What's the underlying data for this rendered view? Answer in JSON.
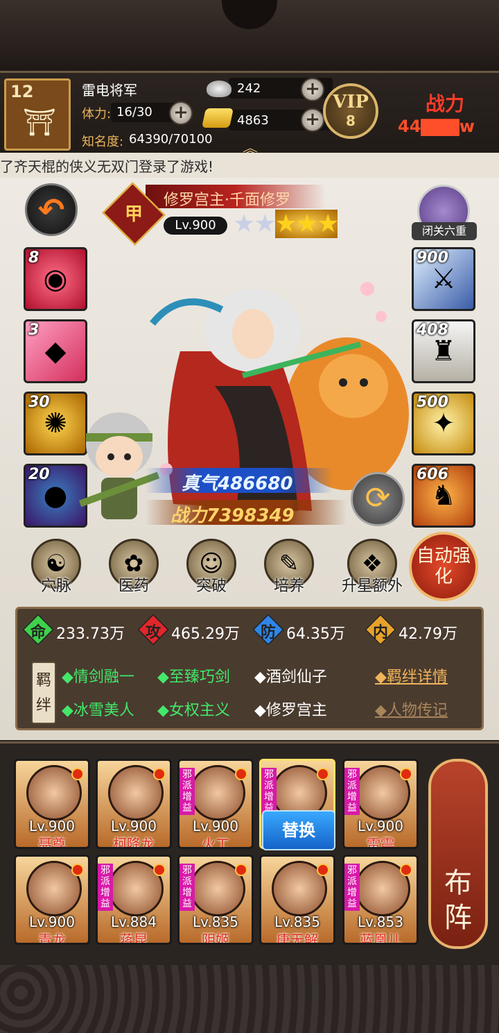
{
  "player": {
    "level": "12",
    "name": "雷电将军",
    "stamina_label": "体力:",
    "stamina_value": "16/30",
    "fame_label": "知名度:",
    "fame_value": "64390/70100",
    "silver": "242",
    "gold": "4863",
    "vip_text": "VIP",
    "vip_level": "8",
    "power_label": "战力",
    "power_value": "44▇▇▇w"
  },
  "marquee": "了齐天棍的侠义无双门登录了游戏!",
  "hero": {
    "rank": "甲",
    "title": "修罗宫主·千面修罗",
    "level": "Lv.900",
    "stars_silver": "★★",
    "stars_gold": "★★★",
    "seclusion_label": "闭关六重",
    "qi_text": "真气486680",
    "power_text": "战力7398349"
  },
  "left_slots": [
    {
      "num": "8",
      "icon": "red-swirl-icon",
      "glyph": "◉"
    },
    {
      "num": "3",
      "icon": "pink-crystal-icon",
      "glyph": "◆"
    },
    {
      "num": "30",
      "icon": "golden-aura-icon",
      "glyph": "✺"
    },
    {
      "num": "20",
      "icon": "blue-orb-icon",
      "glyph": "●"
    }
  ],
  "right_slots": [
    {
      "num": "900",
      "icon": "sword-icon",
      "glyph": "🗡"
    },
    {
      "num": "408",
      "icon": "robe-icon",
      "glyph": "♜"
    },
    {
      "num": "500",
      "icon": "gems-icon",
      "glyph": "✦"
    },
    {
      "num": "606",
      "icon": "tiger-icon",
      "glyph": "🐯"
    }
  ],
  "functions": [
    {
      "label": "穴脉",
      "icon": "meridian-icon",
      "glyph": "☯"
    },
    {
      "label": "医药",
      "icon": "medicine-icon",
      "glyph": "✿"
    },
    {
      "label": "突破",
      "icon": "breakthrough-icon",
      "glyph": "☺"
    },
    {
      "label": "培养",
      "icon": "training-scroll-icon",
      "glyph": "✎"
    },
    {
      "label": "升星额外",
      "icon": "star-up-icon",
      "glyph": "❖"
    }
  ],
  "auto_strengthen": "自动强化",
  "stats": [
    {
      "char": "命",
      "value": "233.73万",
      "color": "#3fd14b"
    },
    {
      "char": "攻",
      "value": "465.29万",
      "color": "#e0272b"
    },
    {
      "char": "防",
      "value": "64.35万",
      "color": "#2f86e8"
    },
    {
      "char": "内",
      "value": "42.79万",
      "color": "#e8a22a"
    }
  ],
  "bond_tag": "羁绊",
  "bonds": [
    {
      "text": "◆情剑融一",
      "active": true
    },
    {
      "text": "◆至臻巧剑",
      "active": true
    },
    {
      "text": "◆酒剑仙子",
      "active": false
    },
    {
      "text": "◆冰雪美人",
      "active": true
    },
    {
      "text": "◆女权主义",
      "active": true
    },
    {
      "text": "◆修罗宫主",
      "active": false
    }
  ],
  "links": {
    "bond_detail": "◆羁绊详情",
    "biography": "◆人物传记"
  },
  "team": [
    {
      "level": "Lv.900",
      "name": "聂尊",
      "evil": false
    },
    {
      "level": "Lv.900",
      "name": "柯降龙",
      "evil": false
    },
    {
      "level": "Lv.900",
      "name": "火工",
      "evil": true
    },
    {
      "level": "",
      "name": "",
      "evil": true,
      "selected": true
    },
    {
      "level": "Lv.900",
      "name": "雷震",
      "evil": true
    },
    {
      "level": "Lv.900",
      "name": "青龙",
      "evil": false
    },
    {
      "level": "Lv.884",
      "name": "蒋昆",
      "evil": true
    },
    {
      "level": "Lv.835",
      "name": "阴姬",
      "evil": true
    },
    {
      "level": "Lv.835",
      "name": "唐无解",
      "evil": false
    },
    {
      "level": "Lv.853",
      "name": "蓝凰儿",
      "evil": true
    }
  ],
  "evil_badge": "邪派增益",
  "replace_label": "替换",
  "formation_label": "布阵"
}
